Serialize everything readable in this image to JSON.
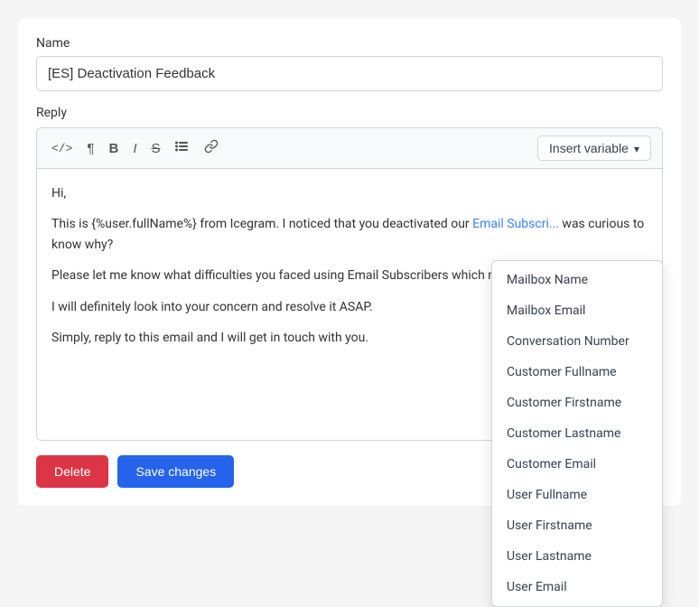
{
  "page": {
    "name_label": "Name",
    "name_value": "[ES] Deactivation Feedback",
    "reply_label": "Reply",
    "insert_variable_label": "Insert variable",
    "editor_content": {
      "line1": "Hi,",
      "line2": "This is {%user.fullName%} from Icegram. I noticed that you deactivated our Email Subscri... was curious to know why?",
      "line3": "Please let me know what difficulties you faced using Email Subscribers which made you... plugin.",
      "line4": "I will definitely look into your concern and resolve it ASAP.",
      "line5": "Simply, reply to this email and I will get in touch with you."
    },
    "link_text": "Email Subscri...",
    "toolbar": {
      "code_icon": "</>",
      "para_icon": "¶",
      "bold_icon": "B",
      "italic_icon": "I",
      "strike_icon": "S",
      "list_icon": "≡",
      "link_icon": "link"
    },
    "dropdown_items": [
      "Mailbox Name",
      "Mailbox Email",
      "Conversation Number",
      "Customer Fullname",
      "Customer Firstname",
      "Customer Lastname",
      "Customer Email",
      "User Fullname",
      "User Firstname",
      "User Lastname",
      "User Email"
    ],
    "buttons": {
      "delete_label": "Delete",
      "save_label": "Save changes"
    }
  }
}
